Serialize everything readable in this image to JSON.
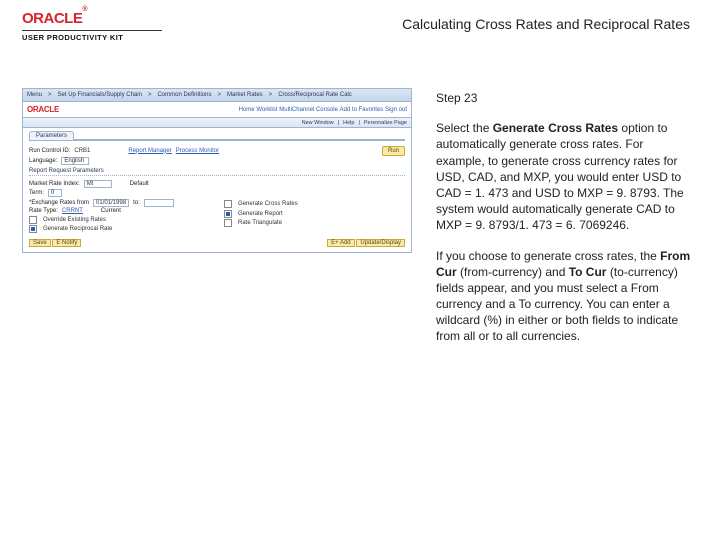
{
  "header": {
    "brand": "ORACLE",
    "brand_suffix": "®",
    "product_line": "USER PRODUCTIVITY KIT",
    "doc_title": "Calculating Cross Rates and Reciprocal Rates"
  },
  "screenshot": {
    "topbar": {
      "left1": "Menu",
      "left2": "Set Up Financials/Supply Chain",
      "left3": "Common Definitions",
      "left4": "Market Rates",
      "left5": "Cross/Reciprocal Rate Calc",
      "r1": "Home",
      "r2": "Worklist",
      "r3": "MultiChannel Console",
      "r4": "Add to Favorites",
      "r5": "Sign out"
    },
    "logo_row": {
      "brand": "ORACLE"
    },
    "sub_bar": {
      "a": "New Window",
      "b": "Help",
      "c": "Personalize Page"
    },
    "tab": "Parameters",
    "run_btn": "Run",
    "row1": {
      "lbl1": "Run Control ID:",
      "val1": "CRB1",
      "lbl2": "Report Manager",
      "lbl3": "Process Monitor"
    },
    "row2": {
      "lbl1": "Language:",
      "val1": "English"
    },
    "group": "Report Request Parameters",
    "rows": {
      "market_rate_index_lbl": "Market Rate Index:",
      "market_rate_index_val": "MI",
      "default_lbl": "Default",
      "term_lbl": "Term:",
      "term_val": "0",
      "exch_from_lbl": "*Exchange Rates from",
      "exch_from_val": "01/01/1998",
      "to_lbl": "to:",
      "rate_type_lbl": "Rate Type:",
      "rate_type_val": "CRRNT",
      "curr_label": "Current"
    },
    "checks": {
      "c1": "Override Existing Rates",
      "c2": "Generate Reciprocal Rate",
      "c3": "Generate Cross Rates",
      "c4": "Generate Report",
      "c5": "Rate Triangulate"
    },
    "footer": {
      "save": "Save",
      "notify_icon": "E",
      "notify": "Notify",
      "add_icon": "E+ Add",
      "update": "Update/Display"
    }
  },
  "pane": {
    "step": "Step 23",
    "p1a": "Select the ",
    "p1b": "Generate Cross Rates",
    "p1c": " option to automatically generate cross rates. For example, to generate cross currency rates for USD, CAD, and MXP, you would enter USD to CAD = 1. 473 and USD to MXP = 9. 8793. The system would automatically generate CAD to MXP = 9. 8793/1. 473 = 6. 7069246.",
    "p2a": "If you choose to generate cross rates, the ",
    "p2b": "From Cur",
    "p2c": " (from-currency) and ",
    "p2d": "To Cur",
    "p2e": " (to-currency) fields appear, and you must select a From currency and a To currency. You can enter a wildcard (%) in either or both fields to indicate from all or to all currencies."
  }
}
